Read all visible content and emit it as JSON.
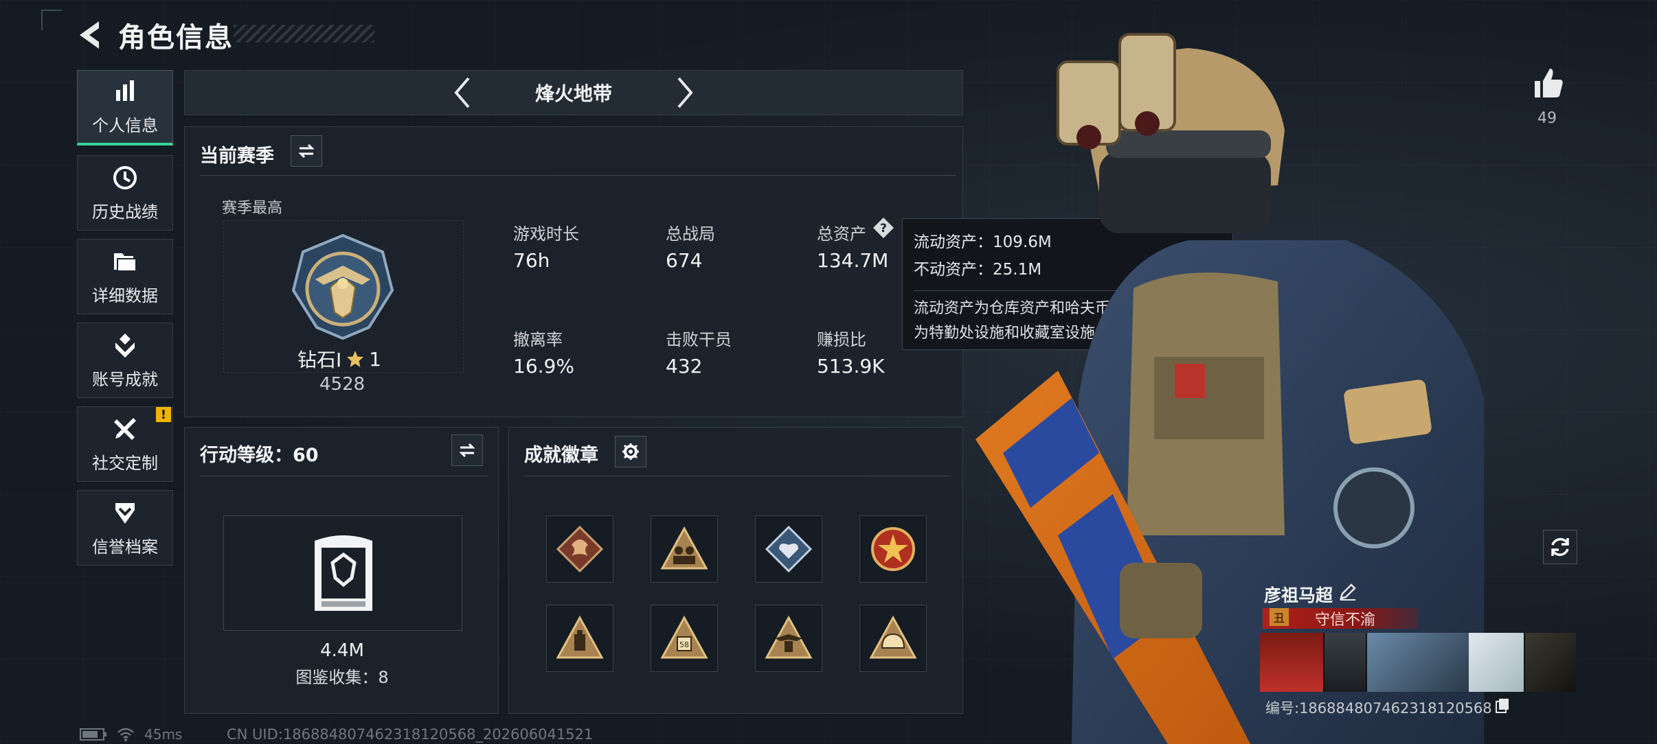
{
  "header": {
    "title": "角色信息"
  },
  "nav": [
    {
      "label": "个人信息",
      "icon": "bar-chart-icon",
      "active": true
    },
    {
      "label": "历史战绩",
      "icon": "history-clock-icon"
    },
    {
      "label": "详细数据",
      "icon": "folder-icon"
    },
    {
      "label": "账号成就",
      "icon": "achievement-icon"
    },
    {
      "label": "社交定制",
      "icon": "tools-icon",
      "badge": "!"
    },
    {
      "label": "信誉档案",
      "icon": "shield-chevron-icon"
    }
  ],
  "mode": {
    "title": "烽火地带"
  },
  "season": {
    "title": "当前赛季",
    "subtitle": "赛季最高",
    "rank_name": "钻石Ⅰ",
    "rank_stars": "1",
    "rank_score": "4528",
    "stats": [
      {
        "label": "游戏时长",
        "value": "76h"
      },
      {
        "label": "总战局",
        "value": "674"
      },
      {
        "label": "总资产",
        "value": "134.7M"
      },
      {
        "label": "撤离率",
        "value": "16.9%"
      },
      {
        "label": "击败干员",
        "value": "432"
      },
      {
        "label": "赚损比",
        "value": "513.9K"
      }
    ]
  },
  "tooltip": {
    "liquid": "流动资产：109.6M",
    "fixed": "不动资产：25.1M",
    "desc1": "流动资产为仓库资产和哈夫币，不动资产",
    "desc2": "为特勤处设施和收藏室设施"
  },
  "level": {
    "title": "行动等级：60",
    "value": "4.4M",
    "collection": "图鉴收集：8"
  },
  "badges": {
    "title": "成就徽章",
    "items": [
      "dragon-badge",
      "soldiers-badge",
      "diamond-heart-badge",
      "star-emblem-badge",
      "lantern-badge",
      "number-badge",
      "eagle-badge",
      "helmet-badge"
    ]
  },
  "player": {
    "likes": "49",
    "name": "彦祖马超",
    "reputation": "守信不渝",
    "id": "编号:1868848074623181205​68"
  },
  "status": {
    "ping": "45ms",
    "uid": "CN UID:1868848074623181205​68_202606041521"
  },
  "colors": {
    "accent": "#35d29b",
    "warning": "#f0b400",
    "reputation": "#b0201c"
  }
}
